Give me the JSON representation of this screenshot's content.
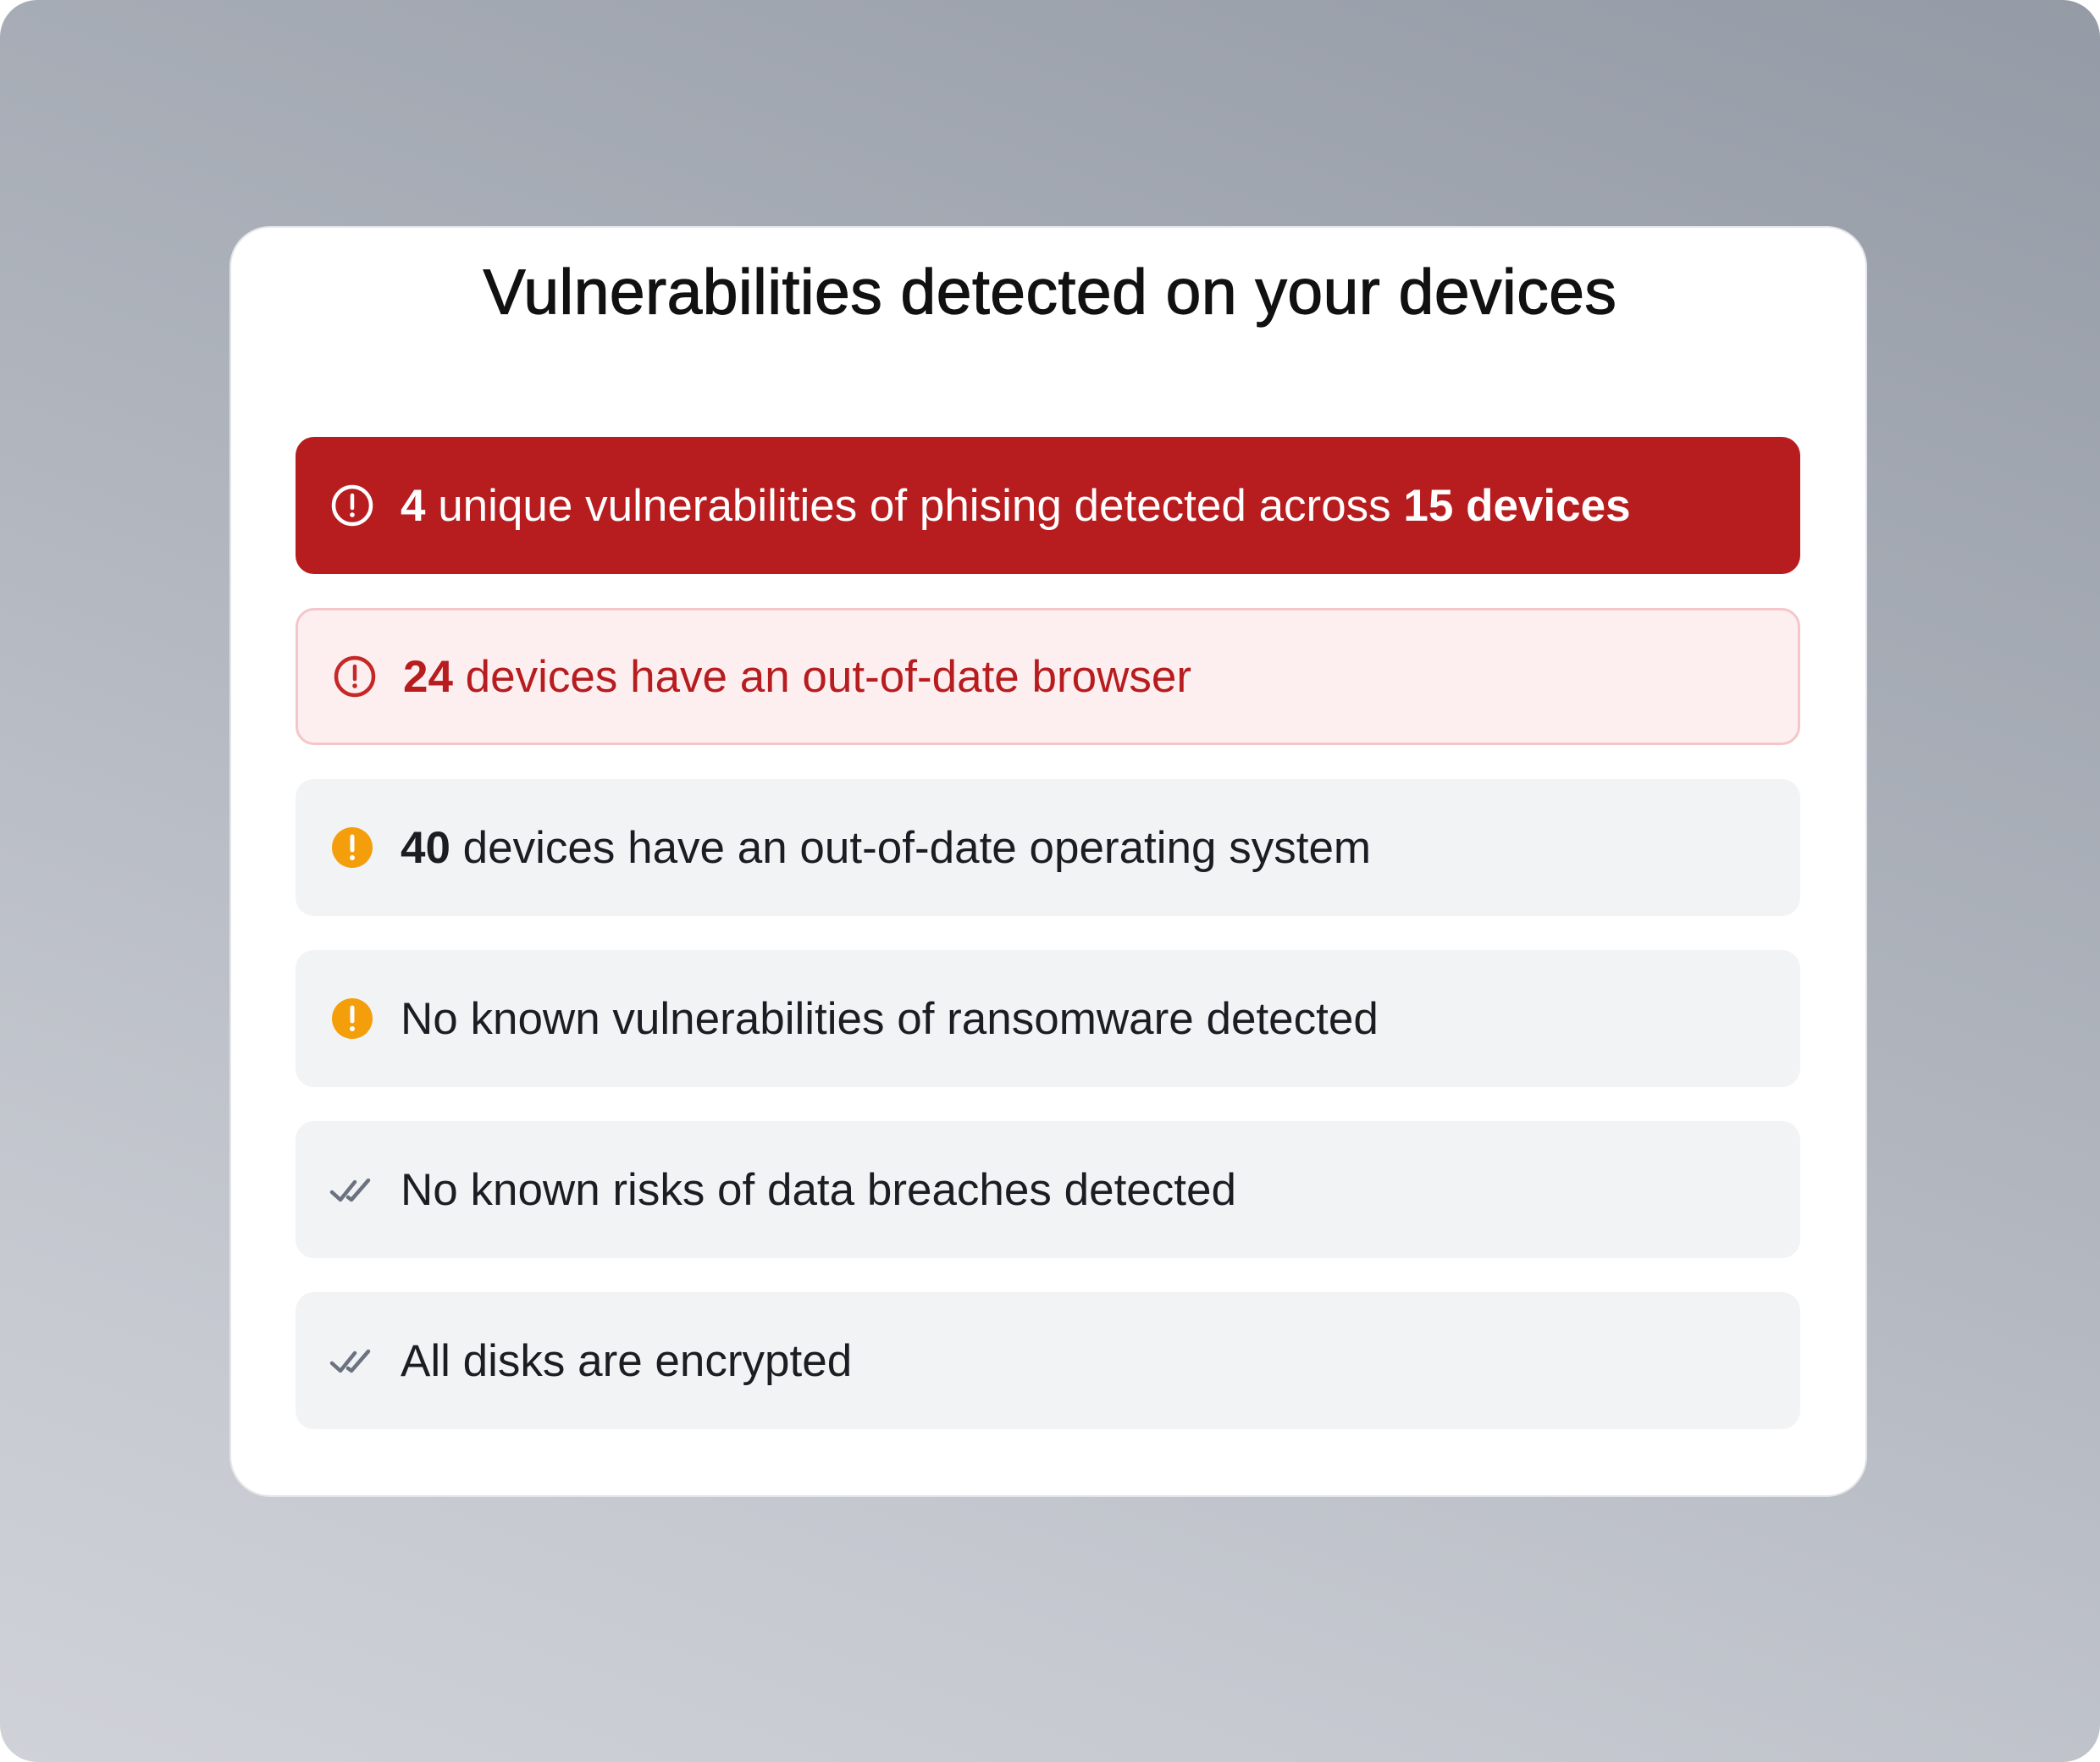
{
  "card": {
    "title": "Vulnerabilities detected on your devices"
  },
  "alerts": [
    {
      "severity": "critical",
      "icon": "alert-circle-icon",
      "count": "4",
      "text_middle": " unique vulnerabilities of phising detected across ",
      "text_strong_end": "15 devices",
      "color": "#b71c1f"
    },
    {
      "severity": "high",
      "icon": "alert-circle-icon",
      "count": "24",
      "text": " devices have an out-of-date browser",
      "color": "#b71c1f"
    },
    {
      "severity": "medium",
      "icon": "warning-filled-icon",
      "count": "40",
      "text": " devices have an out-of-date operating system",
      "color": "#f59e0b"
    },
    {
      "severity": "medium",
      "icon": "warning-filled-icon",
      "text": "No known vulnerabilities of ransomware detected",
      "color": "#f59e0b"
    },
    {
      "severity": "ok",
      "icon": "double-check-icon",
      "text": "No known risks of data breaches detected",
      "color": "#6b7280"
    },
    {
      "severity": "ok",
      "icon": "double-check-icon",
      "text": "All disks are encrypted",
      "color": "#6b7280"
    }
  ]
}
